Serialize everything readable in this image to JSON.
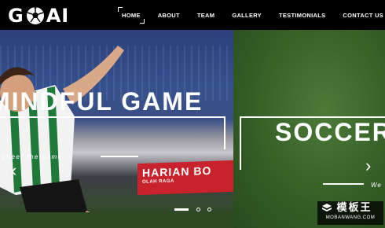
{
  "brand": {
    "logo_text_left": "G",
    "logo_text_right": "AI",
    "logo_icon": "soccer-ball-icon"
  },
  "nav": {
    "items": [
      {
        "label": "HOME",
        "active": true
      },
      {
        "label": "ABOUT"
      },
      {
        "label": "TEAM"
      },
      {
        "label": "GALLERY"
      },
      {
        "label": "TESTIMONIALS"
      },
      {
        "label": "CONTACT US"
      }
    ]
  },
  "slider": {
    "slides": [
      {
        "title": "MINDFUL GAME",
        "subtitle": "cheer the game",
        "banner_text": "HARIAN BO",
        "banner_small": "OLAH RAGA"
      },
      {
        "title": "SOCCER",
        "subtitle": "We"
      }
    ],
    "prev_icon": "chevron-left-icon",
    "next_icon": "chevron-right-icon",
    "pagination": {
      "count": 3,
      "active": 1
    }
  },
  "watermark": {
    "main": "模板王",
    "sub": "MOBANWANG.COM"
  },
  "colors": {
    "header_bg": "#000000",
    "text": "#ffffff",
    "banner": "#c8232c",
    "grass": "#355f26"
  }
}
